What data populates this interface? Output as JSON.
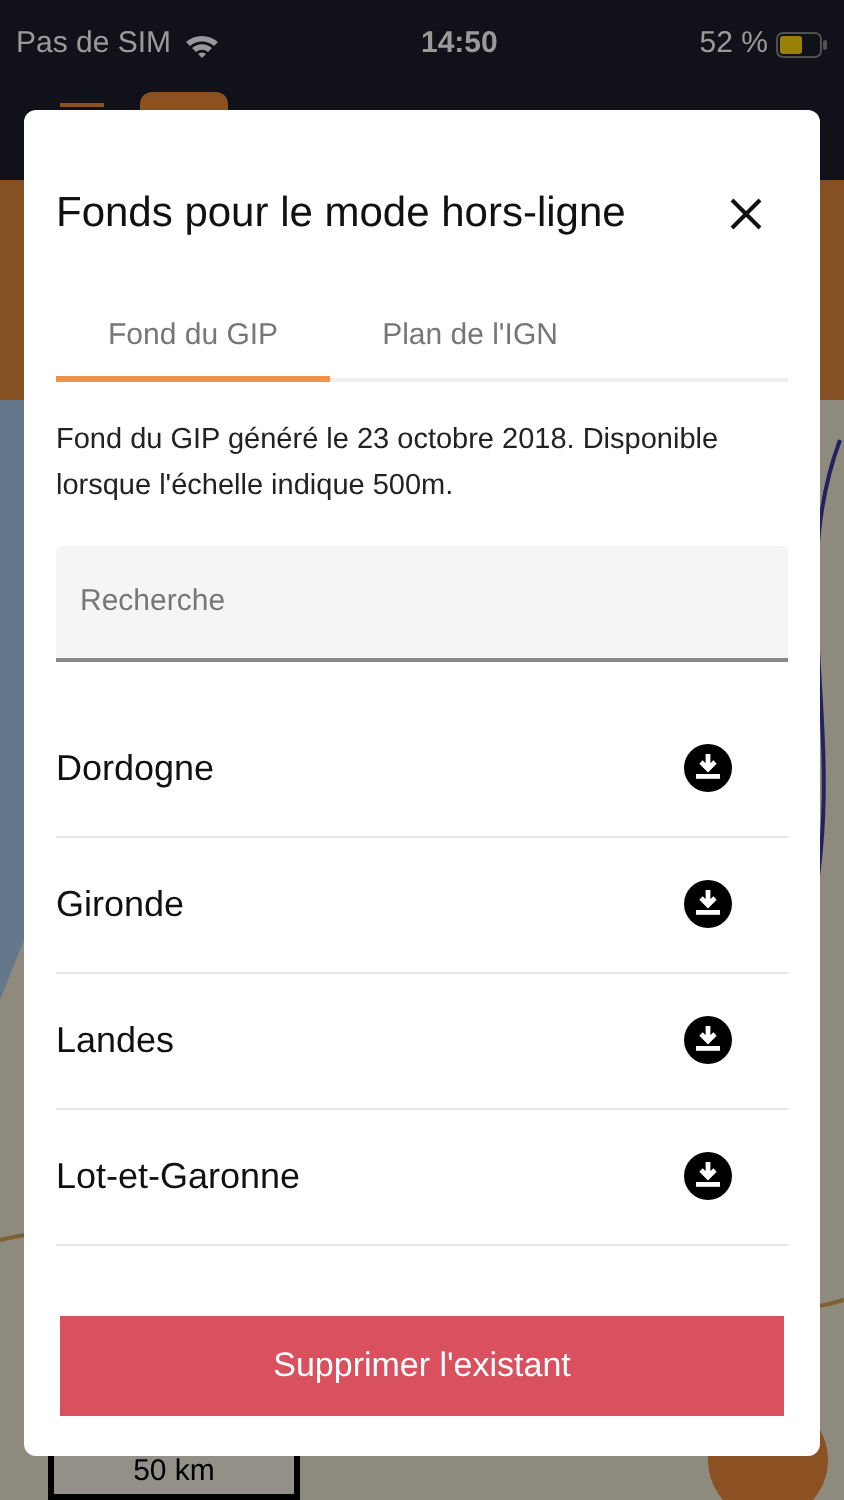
{
  "status_bar": {
    "carrier": "Pas de SIM",
    "time": "14:50",
    "battery": "52 %"
  },
  "map": {
    "scale": "50 km"
  },
  "dialog": {
    "title": "Fonds pour le mode hors-ligne",
    "tabs": [
      {
        "label": "Fond du GIP",
        "selected": true
      },
      {
        "label": "Plan de l'IGN",
        "selected": false
      }
    ],
    "description": "Fond du GIP généré le 23 octobre 2018. Disponible lorsque l'échelle indique 500m.",
    "search": {
      "placeholder": "Recherche"
    },
    "items": [
      {
        "name": "Dordogne"
      },
      {
        "name": "Gironde"
      },
      {
        "name": "Landes"
      },
      {
        "name": "Lot-et-Garonne"
      }
    ],
    "delete_button": "Supprimer l'existant"
  }
}
